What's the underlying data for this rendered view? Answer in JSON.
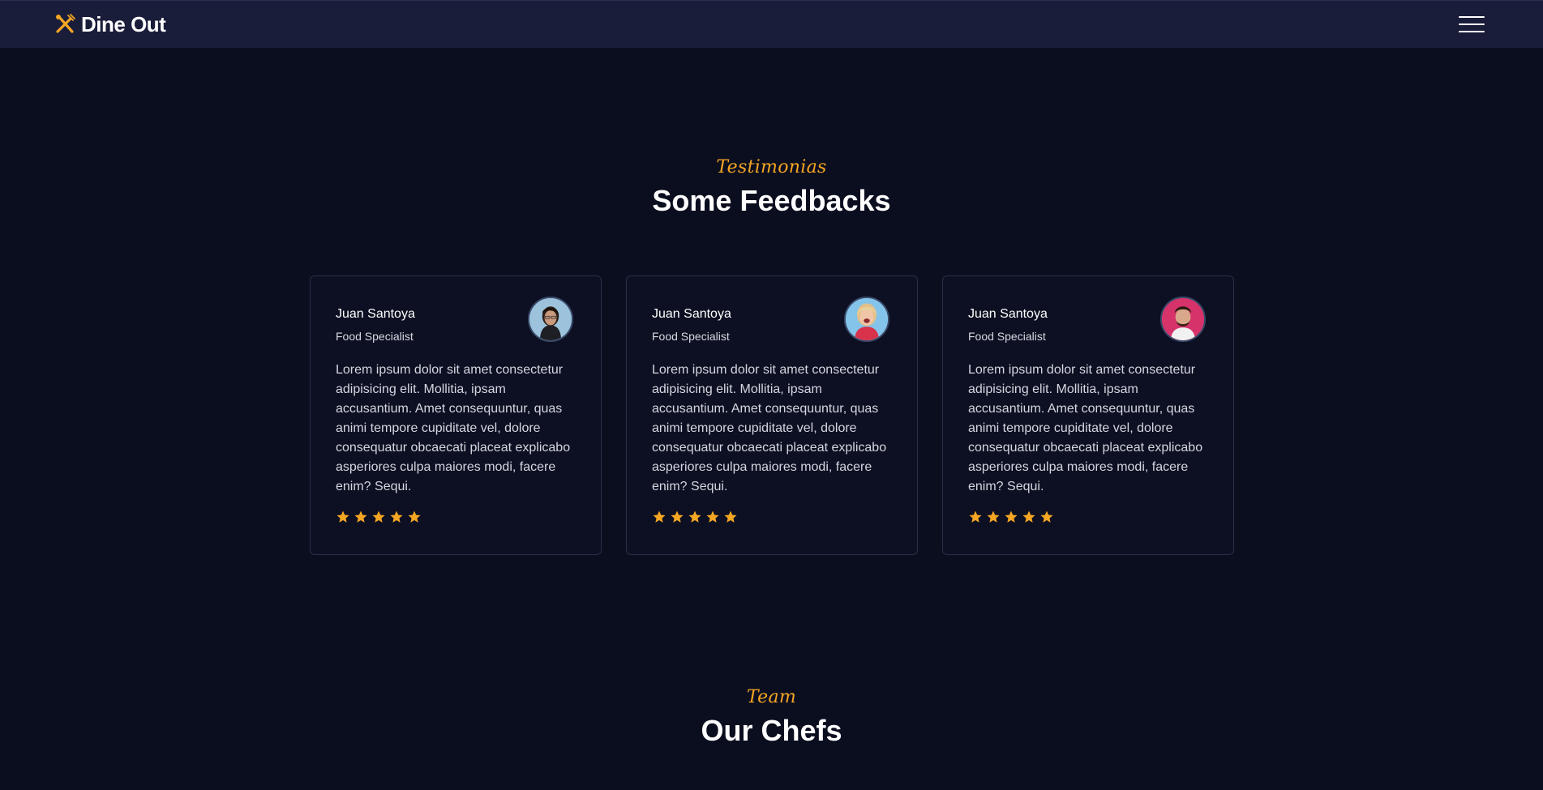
{
  "navbar": {
    "brand": "Dine Out",
    "brand_color": "#f5a623",
    "menu_icon": "hamburger-menu-icon"
  },
  "testimonials": {
    "eyebrow": "Testimonias",
    "heading": "Some Feedbacks",
    "cards": [
      {
        "name": "Juan Santoya",
        "role": "Food Specialist",
        "quote": "Lorem ipsum dolor sit amet consectetur adipisicing elit. Mollitia, ipsam accusantium. Amet consequuntur, quas animi tempore cupiditate vel, dolore consequatur obcaecati placeat explicabo asperiores culpa maiores modi, facere enim? Sequi.",
        "rating": 5,
        "avatar_bg": "#8fb7d4"
      },
      {
        "name": "Juan Santoya",
        "role": "Food Specialist",
        "quote": "Lorem ipsum dolor sit amet consectetur adipisicing elit. Mollitia, ipsam accusantium. Amet consequuntur, quas animi tempore cupiditate vel, dolore consequatur obcaecati placeat explicabo asperiores culpa maiores modi, facere enim? Sequi.",
        "rating": 5,
        "avatar_bg": "#7fbde6"
      },
      {
        "name": "Juan Santoya",
        "role": "Food Specialist",
        "quote": "Lorem ipsum dolor sit amet consectetur adipisicing elit. Mollitia, ipsam accusantium. Amet consequuntur, quas animi tempore cupiditate vel, dolore consequatur obcaecati placeat explicabo asperiores culpa maiores modi, facere enim? Sequi.",
        "rating": 5,
        "avatar_bg": "#d9336a"
      }
    ]
  },
  "team": {
    "eyebrow": "Team",
    "heading": "Our Chefs"
  },
  "colors": {
    "background": "#0b0e1f",
    "navbar": "#1a1d3a",
    "accent": "#f5a623"
  }
}
